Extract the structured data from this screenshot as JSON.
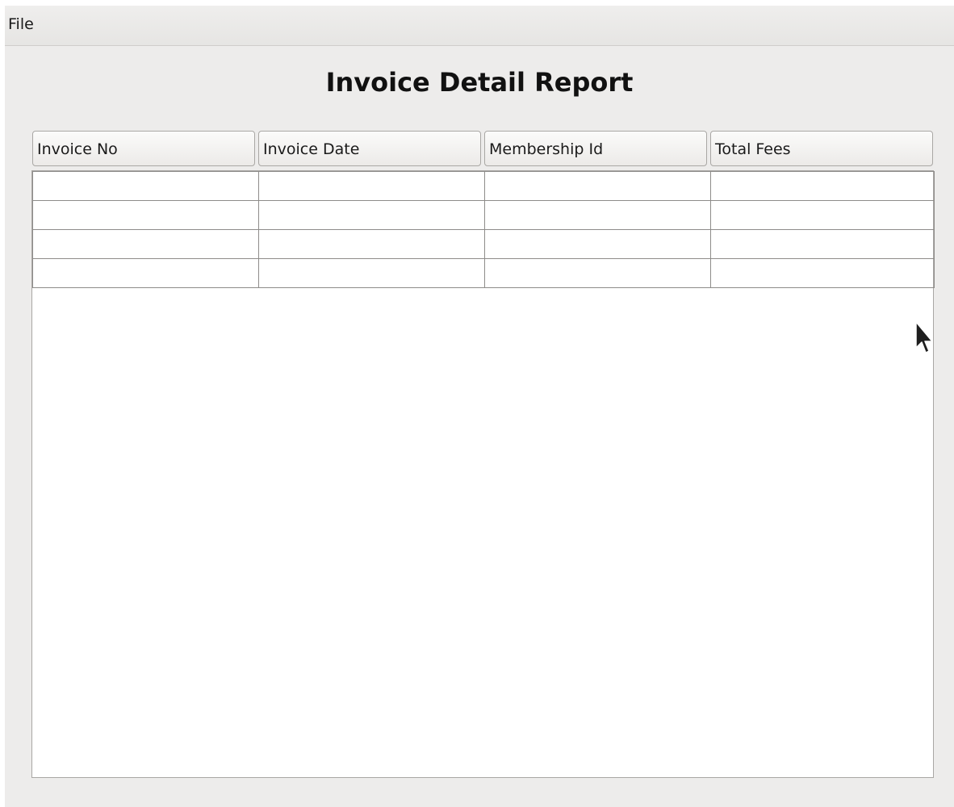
{
  "menubar": {
    "items": [
      {
        "label": "File"
      }
    ]
  },
  "report": {
    "title": "Invoice Detail Report"
  },
  "table": {
    "columns": [
      "Invoice No",
      "Invoice Date",
      "Membership Id",
      "Total Fees"
    ],
    "rows": [
      [
        "",
        "",
        "",
        ""
      ],
      [
        "",
        "",
        "",
        ""
      ],
      [
        "",
        "",
        "",
        ""
      ],
      [
        "",
        "",
        "",
        ""
      ]
    ]
  },
  "icons": {
    "cursor": "mouse-pointer-arrow"
  },
  "colors": {
    "window_background": "#edeceb",
    "table_background": "#ffffff",
    "grid_line": "#8e8c8a"
  }
}
